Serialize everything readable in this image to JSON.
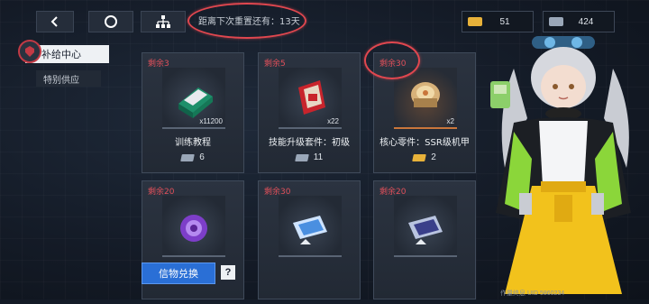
{
  "top_bar": {
    "reset_text": "距离下次重置还有：13天"
  },
  "currencies": [
    {
      "icon": "gold-ticket-icon",
      "value": "51",
      "color": "#e8b23a"
    },
    {
      "icon": "silver-ticket-icon",
      "value": "424",
      "color": "#9aa7b8"
    }
  ],
  "nav": {
    "active": "补给中心",
    "items": [
      "特别供应"
    ]
  },
  "cards": [
    {
      "remain": "剩余3",
      "qty": "x11200",
      "name": "训练教程",
      "price": "6",
      "rarity": "normal",
      "item_icon": "training-manual-icon"
    },
    {
      "remain": "剩余5",
      "qty": "x22",
      "name": "技能升级套件：初级",
      "price": "11",
      "rarity": "normal",
      "item_icon": "skill-kit-icon"
    },
    {
      "remain": "剩余30",
      "qty": "x2",
      "name": "核心零件：SSR级机甲",
      "price": "2",
      "rarity": "ssr",
      "item_icon": "core-part-icon"
    },
    {
      "remain": "剩余20",
      "qty": "",
      "name": "",
      "price": "",
      "rarity": "normal",
      "item_icon": "purple-core-icon"
    },
    {
      "remain": "剩余30",
      "qty": "",
      "name": "",
      "price": "",
      "rarity": "normal",
      "item_icon": "ticket-card-icon"
    },
    {
      "remain": "剩余20",
      "qty": "",
      "name": "",
      "price": "",
      "rarity": "normal",
      "item_icon": "ticket-card-dark-icon"
    }
  ],
  "bottom": {
    "exchange_label": "信物兑换",
    "help_label": "?",
    "info_text": "作量终息 UID 5860234"
  },
  "colors": {
    "accent_blue": "#2a6fd6",
    "remain_red": "#e0505a",
    "highlight_ring": "#e0474f"
  }
}
